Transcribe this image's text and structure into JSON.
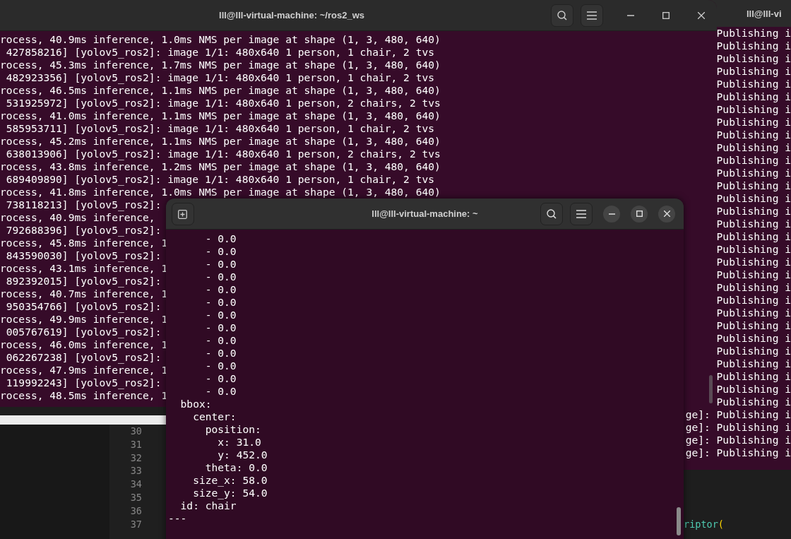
{
  "editor": {
    "lines": [
      {
        "number": "30"
      },
      {
        "number": "31"
      },
      {
        "number": "32"
      },
      {
        "number": "33"
      },
      {
        "number": "34"
      },
      {
        "number": "35"
      },
      {
        "number": "36"
      },
      {
        "number": "37",
        "tokens": [
          {
            "text": "riptor",
            "kind": "function"
          },
          {
            "text": "(",
            "kind": "bracket"
          }
        ]
      }
    ]
  },
  "background_terminal": {
    "title": "lll@lll-vi",
    "lines": [
      "Publishing i",
      "Publishing i",
      "Publishing i",
      "Publishing i",
      "Publishing i",
      "Publishing i",
      "Publishing i",
      "Publishing i",
      "Publishing i",
      "Publishing i",
      "Publishing i",
      "Publishing i",
      "Publishing i",
      "Publishing i",
      "Publishing i",
      "Publishing i",
      "Publishing i",
      "Publishing i",
      "Publishing i",
      "Publishing i",
      "Publishing i",
      "Publishing i",
      "Publishing i",
      "Publishing i",
      "Publishing i",
      "Publishing i",
      "Publishing i",
      "Publishing i",
      "Publishing i",
      "Publishing i",
      "ge]: Publishing i",
      "ge]: Publishing i",
      "ge]: Publishing i",
      "ge]: Publishing i"
    ]
  },
  "log_terminal": {
    "title": "lll@lll-virtual-machine: ~/ros2_ws",
    "lines": [
      "rocess, 40.9ms inference, 1.0ms NMS per image at shape (1, 3, 480, 640)",
      " 427858216] [yolov5_ros2]: image 1/1: 480x640 1 person, 1 chair, 2 tvs",
      "rocess, 45.3ms inference, 1.7ms NMS per image at shape (1, 3, 480, 640)",
      " 482923356] [yolov5_ros2]: image 1/1: 480x640 1 person, 1 chair, 2 tvs",
      "rocess, 46.5ms inference, 1.1ms NMS per image at shape (1, 3, 480, 640)",
      " 531925972] [yolov5_ros2]: image 1/1: 480x640 1 person, 2 chairs, 2 tvs",
      "rocess, 41.0ms inference, 1.1ms NMS per image at shape (1, 3, 480, 640)",
      " 585953711] [yolov5_ros2]: image 1/1: 480x640 1 person, 1 chair, 2 tvs",
      "rocess, 45.2ms inference, 1.1ms NMS per image at shape (1, 3, 480, 640)",
      " 638013906] [yolov5_ros2]: image 1/1: 480x640 1 person, 2 chairs, 2 tvs",
      "rocess, 43.8ms inference, 1.2ms NMS per image at shape (1, 3, 480, 640)",
      " 689409890] [yolov5_ros2]: image 1/1: 480x640 1 person, 1 chair, 2 tvs",
      "rocess, 41.8ms inference, 1.0ms NMS per image at shape (1, 3, 480, 640)",
      " 738118213] [yolov5_ros2]:",
      "rocess, 40.9ms inference,",
      " 792688396] [yolov5_ros2]:",
      "rocess, 45.8ms inference, 1",
      " 843590030] [yolov5_ros2]:",
      "rocess, 43.1ms inference, 1",
      " 892392015] [yolov5_ros2]:",
      "rocess, 40.7ms inference, 1",
      " 950354766] [yolov5_ros2]:",
      "rocess, 49.9ms inference, 1",
      " 005767619] [yolov5_ros2]:",
      "rocess, 46.0ms inference, 1",
      " 062267238] [yolov5_ros2]:",
      "rocess, 47.9ms inference, 1",
      " 119992243] [yolov5_ros2]:",
      "rocess, 48.5ms inference, 1"
    ]
  },
  "active_terminal": {
    "title": "lll@lll-virtual-machine: ~",
    "lines": [
      "      - 0.0",
      "      - 0.0",
      "      - 0.0",
      "      - 0.0",
      "      - 0.0",
      "      - 0.0",
      "      - 0.0",
      "      - 0.0",
      "      - 0.0",
      "      - 0.0",
      "      - 0.0",
      "      - 0.0",
      "      - 0.0",
      "  bbox:",
      "    center:",
      "      position:",
      "        x: 31.0",
      "        y: 452.0",
      "      theta: 0.0",
      "    size_x: 58.0",
      "    size_y: 54.0",
      "  id: chair",
      "---"
    ]
  }
}
